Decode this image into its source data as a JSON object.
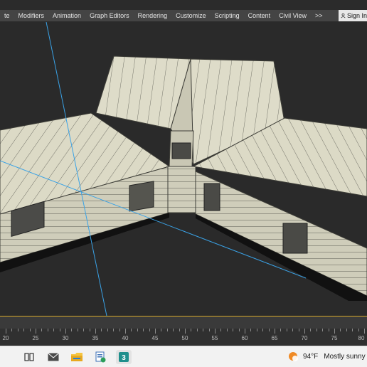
{
  "menubar": {
    "items": [
      "te",
      "Modifiers",
      "Animation",
      "Graph Editors",
      "Rendering",
      "Customize",
      "Scripting",
      "Content",
      "Civil View"
    ],
    "more_label": ">>",
    "sign_in_label": "Sign In"
  },
  "timeline": {
    "ticks": [
      "20",
      "25",
      "30",
      "35",
      "40",
      "45",
      "50",
      "55",
      "60",
      "65",
      "70",
      "75",
      "80"
    ]
  },
  "taskbar": {
    "apps": [
      "task-view-icon",
      "mail-icon",
      "file-explorer-icon",
      "file-manager-icon",
      "3ds-max-icon"
    ],
    "weather": {
      "temp": "94°F",
      "condition": "Mostly sunny"
    }
  },
  "colors": {
    "menubar_bg": "#444444",
    "viewport_bg": "#2a2a2a",
    "roof": "#d9d7c3",
    "wall": "#cfcdbb",
    "frame_line": "#d8a92a",
    "light_line": "#3aa2e6"
  }
}
